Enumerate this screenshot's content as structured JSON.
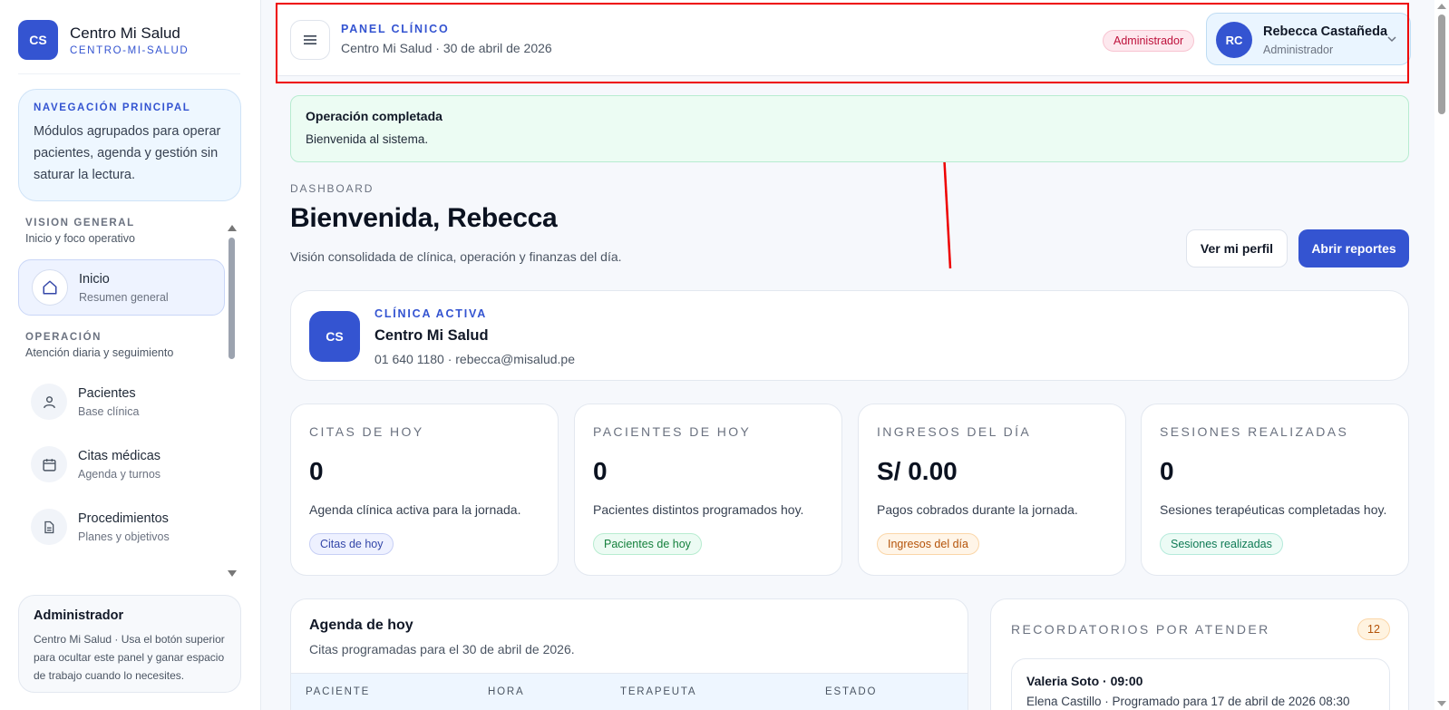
{
  "brand": {
    "initials": "CS",
    "name": "Centro Mi Salud",
    "slug": "CENTRO-MI-SALUD"
  },
  "nav_card": {
    "title": "NAVEGACIÓN PRINCIPAL",
    "text": "Módulos agrupados para operar pacientes, agenda y gestión sin saturar la lectura."
  },
  "nav_groups": [
    {
      "title": "VISIÓN GENERAL",
      "subtitle": "Inicio y foco operativo"
    },
    {
      "title": "OPERACIÓN",
      "subtitle": "Atención diaria y seguimiento"
    }
  ],
  "nav_items": [
    {
      "label": "Inicio",
      "sub": "Resumen general",
      "icon": "home-icon",
      "active": true
    },
    {
      "label": "Pacientes",
      "sub": "Base clínica",
      "icon": "user-icon",
      "active": false
    },
    {
      "label": "Citas médicas",
      "sub": "Agenda y turnos",
      "icon": "calendar-icon",
      "active": false
    },
    {
      "label": "Procedimientos",
      "sub": "Planes y objetivos",
      "icon": "document-icon",
      "active": false
    }
  ],
  "admin_card": {
    "title": "Administrador",
    "text": "Centro Mi Salud · Usa el botón superior para ocultar este panel y ganar espacio de trabajo cuando lo necesites."
  },
  "header": {
    "title": "PANEL CLÍNICO",
    "subtitle": "Centro Mi Salud · 30 de abril de 2026",
    "role_badge": "Administrador",
    "user": {
      "initials": "RC",
      "name": "Rebecca Castañeda",
      "role": "Administrador"
    }
  },
  "alert": {
    "title": "Operación completada",
    "text": "Bienvenida al sistema."
  },
  "page": {
    "eyebrow": "DASHBOARD",
    "title": "Bienvenida, Rebecca",
    "subtitle": "Visión consolidada de clínica, operación y finanzas del día.",
    "btn_profile": "Ver mi perfil",
    "btn_reports": "Abrir reportes"
  },
  "clinic": {
    "initials": "CS",
    "eyebrow": "CLÍNICA ACTIVA",
    "name": "Centro Mi Salud",
    "contact": "01 640 1180 · rebecca@misalud.pe"
  },
  "stats": [
    {
      "label": "CITAS DE HOY",
      "value": "0",
      "desc": "Agenda clínica activa para la jornada.",
      "tag": "Citas de hoy"
    },
    {
      "label": "PACIENTES DE HOY",
      "value": "0",
      "desc": "Pacientes distintos programados hoy.",
      "tag": "Pacientes de hoy"
    },
    {
      "label": "INGRESOS DEL DÍA",
      "value": "S/ 0.00",
      "desc": "Pagos cobrados durante la jornada.",
      "tag": "Ingresos del día"
    },
    {
      "label": "SESIONES REALIZADAS",
      "value": "0",
      "desc": "Sesiones terapéuticas completadas hoy.",
      "tag": "Sesiones realizadas"
    }
  ],
  "colors": {
    "accent": "#3454d1",
    "tag_blue_bg": "#eef1ff",
    "tag_blue_fg": "#3447a8",
    "tag_blue_bd": "#c7cff5",
    "tag_green_bg": "#ecfbf3",
    "tag_green_fg": "#15803d",
    "tag_green_bd": "#b7ecd0",
    "tag_orange_bg": "#fff5e8",
    "tag_orange_fg": "#b45309",
    "tag_orange_bd": "#fbd6a8",
    "tag_teal_bg": "#ecfbf5",
    "tag_teal_fg": "#0f7a55",
    "tag_teal_bd": "#b5eadb"
  },
  "agenda": {
    "title": "Agenda de hoy",
    "subtitle": "Citas programadas para el 30 de abril de 2026.",
    "columns": [
      "PACIENTE",
      "HORA",
      "TERAPEUTA",
      "ESTADO"
    ]
  },
  "reminders": {
    "title": "RECORDATORIOS POR ATENDER",
    "count": "12",
    "items": [
      {
        "name": "Valeria Soto · 09:00",
        "text": "Elena Castillo · Programado para 17 de abril de 2026 08:30"
      }
    ]
  }
}
